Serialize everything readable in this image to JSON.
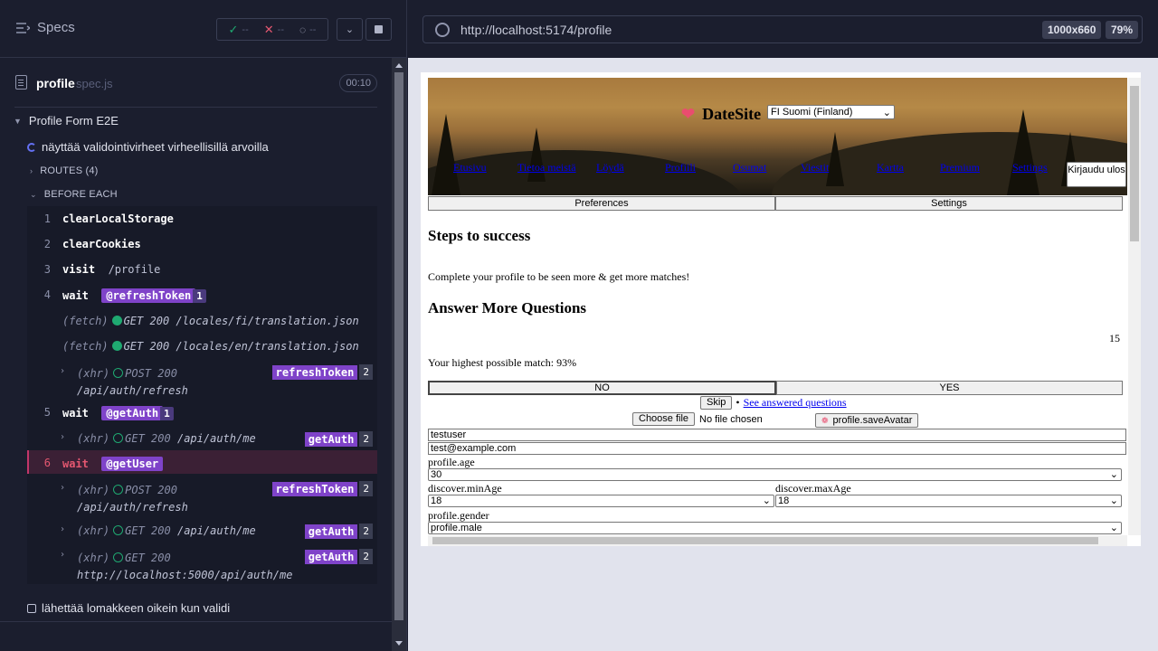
{
  "reporter": {
    "title": "Specs",
    "stats": {
      "passed": "--",
      "failed": "--",
      "pending": "--"
    },
    "spec": {
      "name": "profile",
      "ext": "spec.js",
      "duration": "00:10"
    },
    "suite": "Profile Form E2E",
    "test_running": "näyttää validointivirheet virheellisillä arvoilla",
    "routes_label": "ROUTES (4)",
    "before_each_label": "BEFORE EACH",
    "commands": [
      {
        "num": "1",
        "name": "clearLocalStorage",
        "arg": ""
      },
      {
        "num": "2",
        "name": "clearCookies",
        "arg": ""
      },
      {
        "num": "3",
        "name": "visit",
        "arg": "/profile"
      },
      {
        "num": "4",
        "name": "wait",
        "alias": "@refreshToken",
        "count": "1"
      },
      {
        "num": "5",
        "name": "wait",
        "alias": "@getAuth",
        "count": "1"
      },
      {
        "num": "6",
        "name": "wait",
        "alias": "@getUser"
      }
    ],
    "requests": [
      {
        "type": "(fetch)",
        "method": "GET",
        "status": "200",
        "url": "/locales/fi/translation.json"
      },
      {
        "type": "(fetch)",
        "method": "GET",
        "status": "200",
        "url": "/locales/en/translation.json"
      },
      {
        "type": "(xhr)",
        "method": "POST",
        "status": "200",
        "url": "/api/auth/refresh",
        "alias": "refreshToken",
        "count": "2"
      },
      {
        "type": "(xhr)",
        "method": "GET",
        "status": "200",
        "url": "/api/auth/me",
        "alias": "getAuth",
        "count": "2"
      },
      {
        "type": "(xhr)",
        "method": "POST",
        "status": "200",
        "url": "/api/auth/refresh",
        "alias": "refreshToken",
        "count": "2"
      },
      {
        "type": "(xhr)",
        "method": "GET",
        "status": "200",
        "url": "/api/auth/me",
        "alias": "getAuth",
        "count": "2"
      },
      {
        "type": "(xhr)",
        "method": "GET",
        "status": "200",
        "url": "http://localhost:5000/api/auth/me",
        "alias": "getAuth",
        "count": "2"
      }
    ],
    "test_pending": "lähettää lomakkeen oikein kun validi"
  },
  "browser": {
    "url": "http://localhost:5174/profile",
    "viewport": "1000x660",
    "zoom": "79%"
  },
  "app": {
    "brand": "DateSite",
    "language": "FI Suomi (Finland)",
    "nav": [
      "Etusivu",
      "Tietoa meistä",
      "Löydä",
      "Profiili",
      "Osumat",
      "Viestit",
      "Kartta",
      "Premium",
      "Settings"
    ],
    "logout": "Kirjaudu ulos",
    "tabs": [
      "Preferences",
      "Settings"
    ],
    "steps_title": "Steps to success",
    "steps_text": "Complete your profile to be seen more & get more matches!",
    "questions_title": "Answer More Questions",
    "question_count": "15",
    "highest_match": "Your highest possible match: 93%",
    "no": "NO",
    "yes": "YES",
    "skip": "Skip",
    "bullet": "•",
    "answered_link": "See answered questions",
    "choose_file": "Choose file",
    "no_file": "No file chosen",
    "save_avatar": "profile.saveAvatar",
    "username": "testuser",
    "email": "test@example.com",
    "age_label": "profile.age",
    "age_value": "30",
    "min_age_label": "discover.minAge",
    "min_age_value": "18",
    "max_age_label": "discover.maxAge",
    "max_age_value": "18",
    "gender_label": "profile.gender",
    "gender_value": "profile.male"
  }
}
